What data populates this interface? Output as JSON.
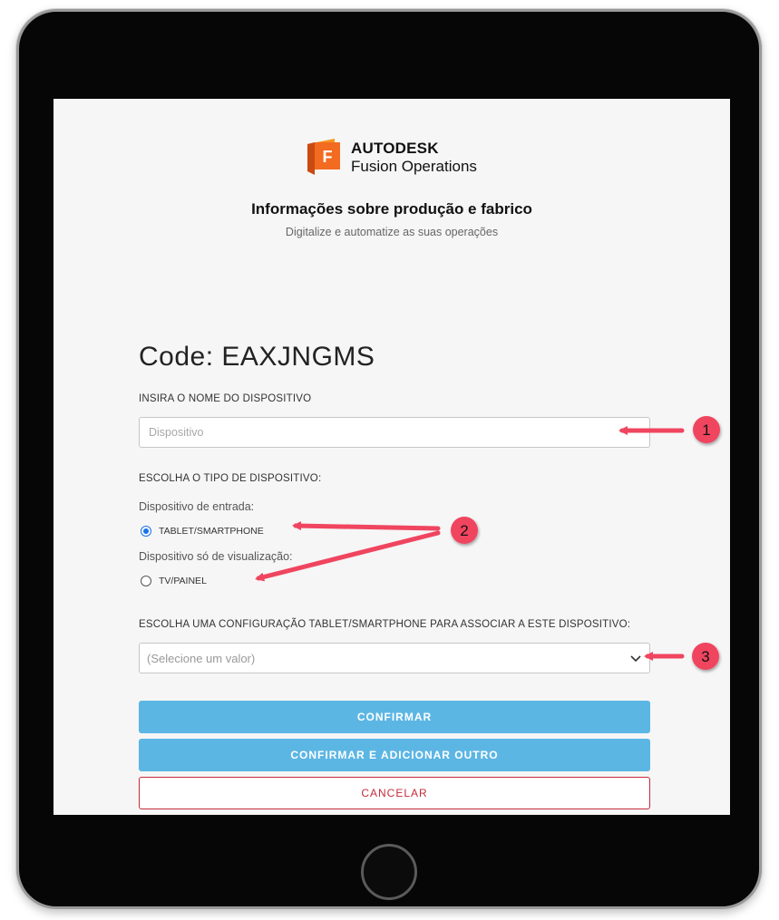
{
  "brand": {
    "name": "AUTODESK",
    "product": "Fusion Operations",
    "logo_letter": "F",
    "logo_colors": [
      "#f26b21",
      "#f7941d",
      "#c94a12"
    ]
  },
  "header": {
    "title": "Informações sobre produção e fabrico",
    "subtitle": "Digitalize e automatize as suas operações"
  },
  "form": {
    "code_line": "Code: EAXJNGMS",
    "device_name_label": "INSIRA O NOME DO DISPOSITIVO",
    "device_name_placeholder": "Dispositivo",
    "device_name_value": "",
    "device_type_label": "ESCOLHA O TIPO DE DISPOSITIVO:",
    "input_device_label": "Dispositivo de entrada:",
    "option_tablet": "TABLET/SMARTPHONE",
    "view_only_label": "Dispositivo só de visualização:",
    "option_tv": "TV/PAINEL",
    "selected_type": "TABLET/SMARTPHONE",
    "config_label": "ESCOLHA UMA CONFIGURAÇÃO TABLET/SMARTPHONE PARA ASSOCIAR A ESTE DISPOSITIVO:",
    "config_placeholder": "(Selecione um valor)"
  },
  "buttons": {
    "confirm": "CONFIRMAR",
    "confirm_add": "CONFIRMAR E ADICIONAR OUTRO",
    "cancel": "CANCELAR"
  },
  "annotations": {
    "callouts": [
      "1",
      "2",
      "3"
    ],
    "color": "#f0455f"
  },
  "colors": {
    "primary_button": "#5cb6e4",
    "cancel": "#c62b3a",
    "radio_selected": "#1a73e8"
  }
}
